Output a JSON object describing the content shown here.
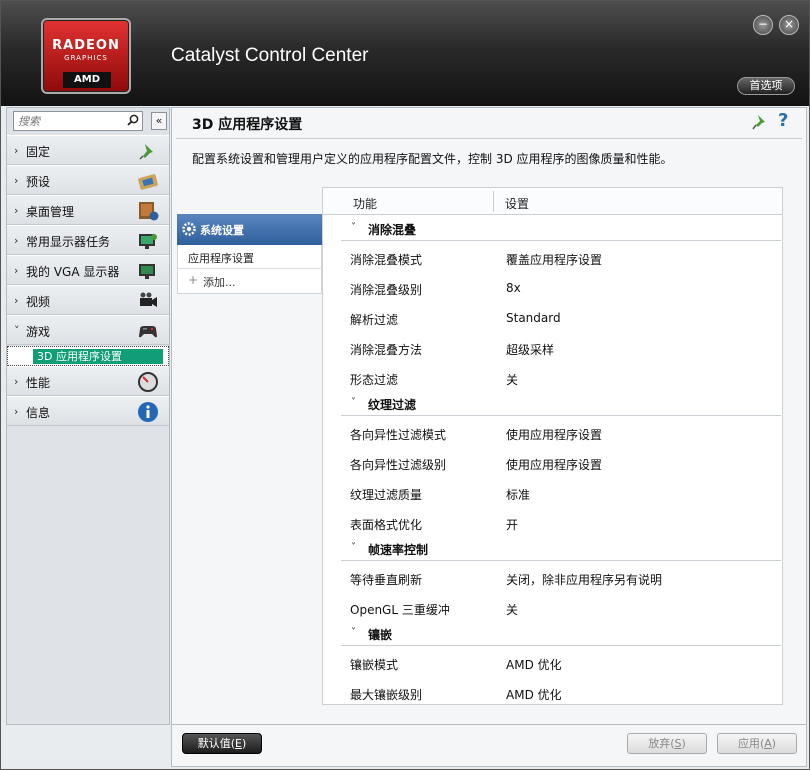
{
  "window": {
    "title": "Catalyst Control Center",
    "logo": {
      "line1": "RADEON",
      "line2": "GRAPHICS",
      "line3": "AMD"
    },
    "minimize_label": "−",
    "close_label": "×",
    "preferences_label": "首选项"
  },
  "sidebar": {
    "search_placeholder": "搜索",
    "collapse_label": "«",
    "items": [
      {
        "label": "固定",
        "icon": "pin-icon"
      },
      {
        "label": "预设",
        "icon": "preset-icon"
      },
      {
        "label": "桌面管理",
        "icon": "desktop-icon"
      },
      {
        "label": "常用显示器任务",
        "icon": "display-tasks-icon"
      },
      {
        "label": "我的 VGA 显示器",
        "icon": "vga-monitor-icon"
      },
      {
        "label": "视频",
        "icon": "video-camera-icon"
      },
      {
        "label": "游戏",
        "icon": "gamepad-icon",
        "expanded": true
      },
      {
        "label": "性能",
        "icon": "gauge-icon"
      },
      {
        "label": "信息",
        "icon": "info-icon"
      }
    ],
    "active_sub": "3D 应用程序设置"
  },
  "main": {
    "title": "3D 应用程序设置",
    "description": "配置系统设置和管理用户定义的应用程序配置文件，控制 3D 应用程序的图像质量和性能。",
    "profiles": {
      "system_tab": "系统设置",
      "app_settings": "应用程序设置",
      "add": "添加..."
    },
    "table": {
      "col_feature": "功能",
      "col_setting": "设置",
      "sections": [
        {
          "title": "消除混叠",
          "rows": [
            {
              "k": "消除混叠模式",
              "v": "覆盖应用程序设置"
            },
            {
              "k": "消除混叠级别",
              "v": "8x"
            },
            {
              "k": "解析过滤",
              "v": "Standard"
            },
            {
              "k": "消除混叠方法",
              "v": "超级采样"
            },
            {
              "k": "形态过滤",
              "v": "关"
            }
          ]
        },
        {
          "title": "纹理过滤",
          "rows": [
            {
              "k": "各向异性过滤模式",
              "v": "使用应用程序设置"
            },
            {
              "k": "各向异性过滤级别",
              "v": "使用应用程序设置"
            },
            {
              "k": "纹理过滤质量",
              "v": "标准"
            },
            {
              "k": "表面格式优化",
              "v": "开"
            }
          ]
        },
        {
          "title": "帧速率控制",
          "rows": [
            {
              "k": "等待垂直刷新",
              "v": "关闭，除非应用程序另有说明"
            },
            {
              "k": "OpenGL 三重缓冲",
              "v": "关"
            }
          ]
        },
        {
          "title": "镶嵌",
          "rows": [
            {
              "k": "镶嵌模式",
              "v": "AMD 优化"
            },
            {
              "k": "最大镶嵌级别",
              "v": "AMD 优化"
            }
          ]
        }
      ]
    }
  },
  "footer": {
    "default_label": "默认值",
    "default_key": "E",
    "discard_label": "放弃",
    "discard_key": "S",
    "apply_label": "应用",
    "apply_key": "A"
  },
  "colors": {
    "accent": "#119d76",
    "tab_blue": "#3c6aa7",
    "header_dark": "#1e1e1e"
  }
}
